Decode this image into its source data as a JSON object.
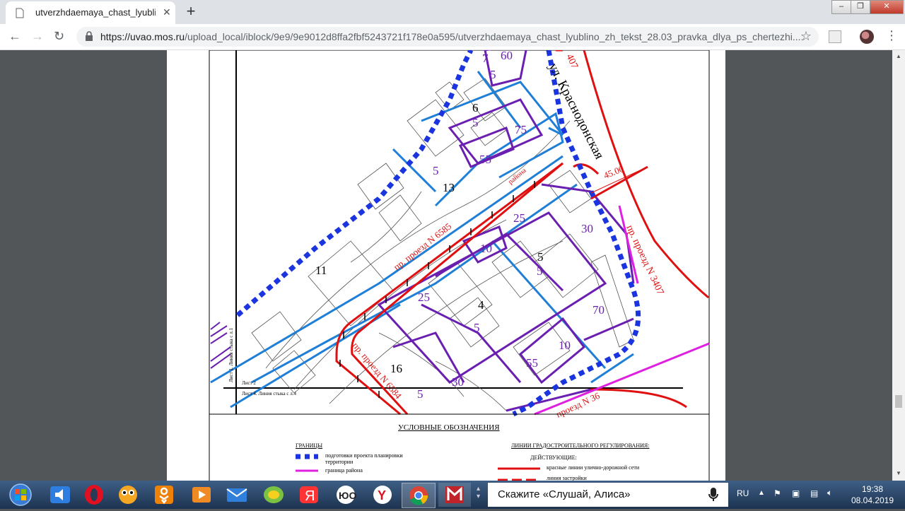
{
  "browser": {
    "tab_title": "utverzhdaemaya_chast_lyublino_",
    "url_domain": "https://uvao.mos.ru",
    "url_rest": "/upload_local/iblock/9e9/9e9012d8ffa2fbf5243721f178e0a595/utverzhdaemaya_chast_lyublino_zh_tekst_28.03_pravka_dlya_ps_chertezhi...."
  },
  "map": {
    "street_name": "ул. Краснодонская",
    "proezd_3407": "пр. проезд N 3407",
    "proezd_3407_top": "407",
    "proezd_6584": "пр. проезд N 6584",
    "proezd_6585": "пр. проезд N 6585",
    "proezd_bottom": "проезд N 36",
    "rayon_label": "района",
    "distance": "45.00",
    "block_numbers": [
      "7",
      "60",
      "5",
      "6",
      "5",
      "75",
      "55",
      "5",
      "13",
      "25",
      "30",
      "10",
      "5",
      "5",
      "11",
      "25",
      "4",
      "70",
      "5",
      "10",
      "55",
      "16",
      "30",
      "5"
    ],
    "sheet_label_1": "Лист 2",
    "sheet_label_2": "Лист 4. Линия стыка с л.4",
    "sheet_label_vertical": "Лист 1. Линия стыка с л.1"
  },
  "legend": {
    "title": "УСЛОВНЫЕ ОБОЗНАЧЕНИЯ",
    "bounds_heading": "ГРАНИЦЫ",
    "bound_1": "подготовки проекта планировки территории",
    "bound_2": "граница района",
    "lines_heading": "ЛИНИИ ГРАДОСТРОИТЕЛЬНОГО РЕГУЛИРОВАНИЯ:",
    "active_heading": "ДЕЙСТВУЮЩИЕ:",
    "line_1": "красные линии улично-дорожной сети",
    "line_2": "линия застройки"
  },
  "taskbar": {
    "alice_prompt": "Скажите «Слушай, Алиса»",
    "lang": "RU",
    "time": "19:38",
    "date": "08.04.2019"
  },
  "colors": {
    "project_boundary": "#1a35e0",
    "district_boundary": "#e020e0",
    "red_lines": "#e01010",
    "blue_lines": "#1f7fd6",
    "purple_blocks": "#6a1fb0"
  }
}
